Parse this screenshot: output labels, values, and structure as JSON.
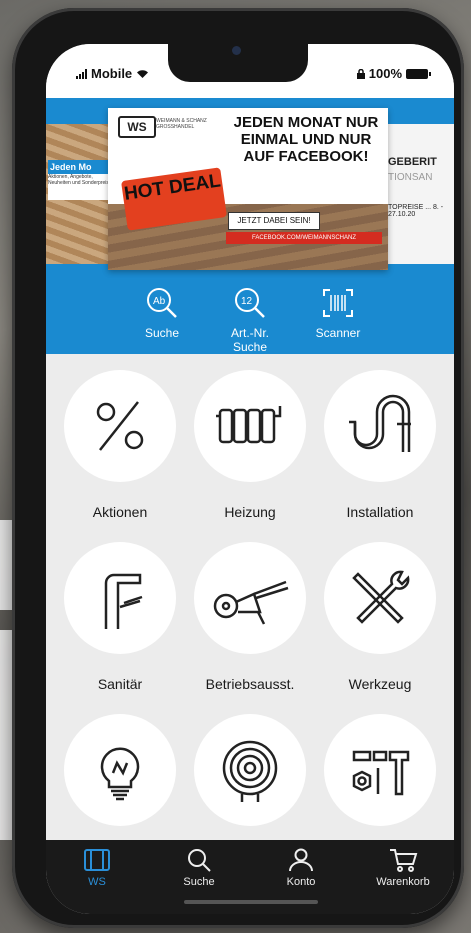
{
  "status_bar": {
    "carrier": "Mobile",
    "battery": "100%"
  },
  "banner": {
    "left_title": "Jeden Mo",
    "left_small": "Aktionen, Angebote, Neuheiten und Sonderpreise",
    "logo": "WS",
    "logo_text": "WEIMANN & SCHANZ GROSSHANDEL",
    "headline": "JEDEN MONAT NUR EINMAL UND NUR AUF FACEBOOK!",
    "hot_deal": "HOT DEAL",
    "cta": "JETZT DABEI SEIN!",
    "facebook_url": "FACEBOOK.COM/WEIMANNSCHANZ",
    "right_title": "GEBERIT",
    "right_sub": "TIONSAN",
    "right_small": "TOPREISE ... 8. - 27.10.20"
  },
  "quick_actions": [
    {
      "label": "Suche",
      "icon": "text-search-icon"
    },
    {
      "label": "Art.-Nr. Suche",
      "icon": "number-search-icon"
    },
    {
      "label": "Scanner",
      "icon": "barcode-scanner-icon"
    }
  ],
  "categories": [
    {
      "label": "Aktionen",
      "icon": "percent-icon"
    },
    {
      "label": "Heizung",
      "icon": "radiator-icon"
    },
    {
      "label": "Installation",
      "icon": "pipe-icon"
    },
    {
      "label": "Sanitär",
      "icon": "faucet-icon"
    },
    {
      "label": "Betriebsausst.",
      "icon": "wheelbarrow-icon"
    },
    {
      "label": "Werkzeug",
      "icon": "tools-icon"
    },
    {
      "label": "",
      "icon": "lightbulb-icon"
    },
    {
      "label": "",
      "icon": "coil-icon"
    },
    {
      "label": "",
      "icon": "fasteners-icon"
    }
  ],
  "tabs": [
    {
      "label": "WS",
      "icon": "ws-tab-icon",
      "active": true
    },
    {
      "label": "Suche",
      "icon": "search-icon",
      "active": false
    },
    {
      "label": "Konto",
      "icon": "user-icon",
      "active": false
    },
    {
      "label": "Warenkorb",
      "icon": "cart-icon",
      "active": false
    }
  ],
  "colors": {
    "accent": "#1a8ad0",
    "tabbar": "#1a1a1a",
    "active_tab": "#2a8fd8"
  }
}
